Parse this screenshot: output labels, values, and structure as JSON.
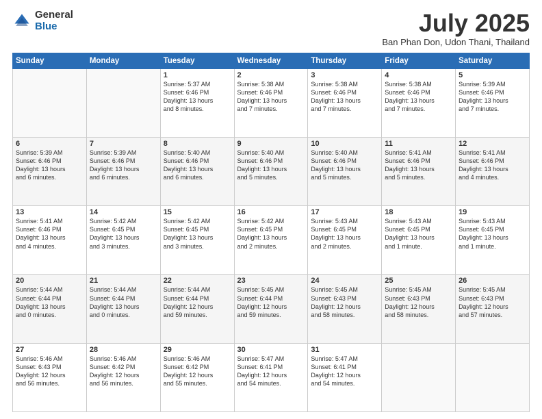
{
  "logo": {
    "general": "General",
    "blue": "Blue"
  },
  "title": "July 2025",
  "location": "Ban Phan Don, Udon Thani, Thailand",
  "days_header": [
    "Sunday",
    "Monday",
    "Tuesday",
    "Wednesday",
    "Thursday",
    "Friday",
    "Saturday"
  ],
  "weeks": [
    [
      {
        "day": "",
        "info": ""
      },
      {
        "day": "",
        "info": ""
      },
      {
        "day": "1",
        "info": "Sunrise: 5:37 AM\nSunset: 6:46 PM\nDaylight: 13 hours\nand 8 minutes."
      },
      {
        "day": "2",
        "info": "Sunrise: 5:38 AM\nSunset: 6:46 PM\nDaylight: 13 hours\nand 7 minutes."
      },
      {
        "day": "3",
        "info": "Sunrise: 5:38 AM\nSunset: 6:46 PM\nDaylight: 13 hours\nand 7 minutes."
      },
      {
        "day": "4",
        "info": "Sunrise: 5:38 AM\nSunset: 6:46 PM\nDaylight: 13 hours\nand 7 minutes."
      },
      {
        "day": "5",
        "info": "Sunrise: 5:39 AM\nSunset: 6:46 PM\nDaylight: 13 hours\nand 7 minutes."
      }
    ],
    [
      {
        "day": "6",
        "info": "Sunrise: 5:39 AM\nSunset: 6:46 PM\nDaylight: 13 hours\nand 6 minutes."
      },
      {
        "day": "7",
        "info": "Sunrise: 5:39 AM\nSunset: 6:46 PM\nDaylight: 13 hours\nand 6 minutes."
      },
      {
        "day": "8",
        "info": "Sunrise: 5:40 AM\nSunset: 6:46 PM\nDaylight: 13 hours\nand 6 minutes."
      },
      {
        "day": "9",
        "info": "Sunrise: 5:40 AM\nSunset: 6:46 PM\nDaylight: 13 hours\nand 5 minutes."
      },
      {
        "day": "10",
        "info": "Sunrise: 5:40 AM\nSunset: 6:46 PM\nDaylight: 13 hours\nand 5 minutes."
      },
      {
        "day": "11",
        "info": "Sunrise: 5:41 AM\nSunset: 6:46 PM\nDaylight: 13 hours\nand 5 minutes."
      },
      {
        "day": "12",
        "info": "Sunrise: 5:41 AM\nSunset: 6:46 PM\nDaylight: 13 hours\nand 4 minutes."
      }
    ],
    [
      {
        "day": "13",
        "info": "Sunrise: 5:41 AM\nSunset: 6:46 PM\nDaylight: 13 hours\nand 4 minutes."
      },
      {
        "day": "14",
        "info": "Sunrise: 5:42 AM\nSunset: 6:45 PM\nDaylight: 13 hours\nand 3 minutes."
      },
      {
        "day": "15",
        "info": "Sunrise: 5:42 AM\nSunset: 6:45 PM\nDaylight: 13 hours\nand 3 minutes."
      },
      {
        "day": "16",
        "info": "Sunrise: 5:42 AM\nSunset: 6:45 PM\nDaylight: 13 hours\nand 2 minutes."
      },
      {
        "day": "17",
        "info": "Sunrise: 5:43 AM\nSunset: 6:45 PM\nDaylight: 13 hours\nand 2 minutes."
      },
      {
        "day": "18",
        "info": "Sunrise: 5:43 AM\nSunset: 6:45 PM\nDaylight: 13 hours\nand 1 minute."
      },
      {
        "day": "19",
        "info": "Sunrise: 5:43 AM\nSunset: 6:45 PM\nDaylight: 13 hours\nand 1 minute."
      }
    ],
    [
      {
        "day": "20",
        "info": "Sunrise: 5:44 AM\nSunset: 6:44 PM\nDaylight: 13 hours\nand 0 minutes."
      },
      {
        "day": "21",
        "info": "Sunrise: 5:44 AM\nSunset: 6:44 PM\nDaylight: 13 hours\nand 0 minutes."
      },
      {
        "day": "22",
        "info": "Sunrise: 5:44 AM\nSunset: 6:44 PM\nDaylight: 12 hours\nand 59 minutes."
      },
      {
        "day": "23",
        "info": "Sunrise: 5:45 AM\nSunset: 6:44 PM\nDaylight: 12 hours\nand 59 minutes."
      },
      {
        "day": "24",
        "info": "Sunrise: 5:45 AM\nSunset: 6:43 PM\nDaylight: 12 hours\nand 58 minutes."
      },
      {
        "day": "25",
        "info": "Sunrise: 5:45 AM\nSunset: 6:43 PM\nDaylight: 12 hours\nand 58 minutes."
      },
      {
        "day": "26",
        "info": "Sunrise: 5:45 AM\nSunset: 6:43 PM\nDaylight: 12 hours\nand 57 minutes."
      }
    ],
    [
      {
        "day": "27",
        "info": "Sunrise: 5:46 AM\nSunset: 6:43 PM\nDaylight: 12 hours\nand 56 minutes."
      },
      {
        "day": "28",
        "info": "Sunrise: 5:46 AM\nSunset: 6:42 PM\nDaylight: 12 hours\nand 56 minutes."
      },
      {
        "day": "29",
        "info": "Sunrise: 5:46 AM\nSunset: 6:42 PM\nDaylight: 12 hours\nand 55 minutes."
      },
      {
        "day": "30",
        "info": "Sunrise: 5:47 AM\nSunset: 6:41 PM\nDaylight: 12 hours\nand 54 minutes."
      },
      {
        "day": "31",
        "info": "Sunrise: 5:47 AM\nSunset: 6:41 PM\nDaylight: 12 hours\nand 54 minutes."
      },
      {
        "day": "",
        "info": ""
      },
      {
        "day": "",
        "info": ""
      }
    ]
  ]
}
